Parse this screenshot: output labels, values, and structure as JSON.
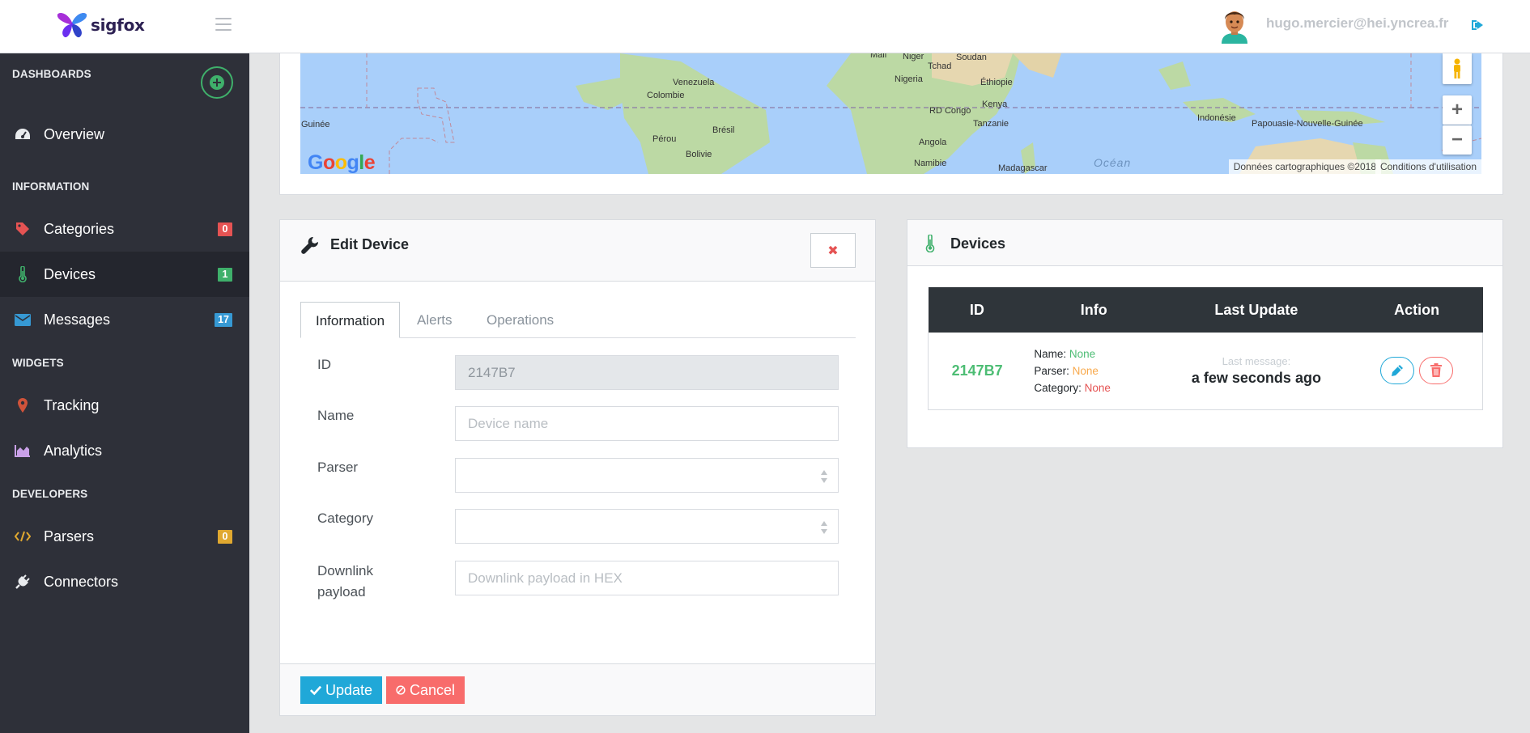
{
  "app": {
    "brand": "sigfox",
    "user_email": "hugo.mercier@hei.yncrea.fr"
  },
  "sidebar": {
    "sections": {
      "dashboards": "DASHBOARDS",
      "information": "INFORMATION",
      "widgets": "WIDGETS",
      "developers": "DEVELOPERS"
    },
    "items": [
      {
        "label": "Overview",
        "icon": "dashboard-icon"
      },
      {
        "label": "Categories",
        "icon": "tag-icon",
        "badge": "0",
        "badge_color": "#e55353"
      },
      {
        "label": "Devices",
        "icon": "thermometer-icon",
        "badge": "1",
        "badge_color": "#3fb06b"
      },
      {
        "label": "Messages",
        "icon": "envelope-icon",
        "badge": "17",
        "badge_color": "#3699d4"
      },
      {
        "label": "Tracking",
        "icon": "map-marker-icon"
      },
      {
        "label": "Analytics",
        "icon": "area-chart-icon"
      },
      {
        "label": "Parsers",
        "icon": "code-icon",
        "badge": "0",
        "badge_color": "#e0a830"
      },
      {
        "label": "Connectors",
        "icon": "plug-icon"
      }
    ]
  },
  "map": {
    "labels": {
      "mali": "Mali",
      "niger": "Niger",
      "soudan": "Soudan",
      "tchad": "Tchad",
      "venezuela": "Venezuela",
      "colombie": "Colombie",
      "nigeria": "Nigeria",
      "ethiopie": "Éthiopie",
      "guinee": "Guinée",
      "kenya": "Kenya",
      "rdcongo": "RD Congo",
      "indonesie": "Indonésie",
      "papouasie": "Papouasie-Nouvelle-Guinée",
      "bresil": "Brésil",
      "tanzanie": "Tanzanie",
      "perou": "Pérou",
      "angola": "Angola",
      "bolivie": "Bolivie",
      "namibie": "Namibie",
      "madagascar": "Madagascar",
      "ocean": "Océan"
    },
    "attribution": "Données cartographiques ©2018",
    "terms": "Conditions d'utilisation",
    "zoom_in": "+",
    "zoom_out": "−"
  },
  "edit_device": {
    "title": "Edit Device",
    "close_symbol": "✖",
    "tabs": [
      "Information",
      "Alerts",
      "Operations"
    ],
    "active_tab": "Information",
    "fields": {
      "id": {
        "label": "ID",
        "value": "2147B7"
      },
      "name": {
        "label": "Name",
        "placeholder": "Device name",
        "value": ""
      },
      "parser": {
        "label": "Parser",
        "value": ""
      },
      "category": {
        "label": "Category",
        "value": ""
      },
      "downlink": {
        "label_line1": "Downlink",
        "label_line2": "payload",
        "placeholder": "Downlink payload in HEX",
        "value": ""
      }
    },
    "update_label": "Update",
    "cancel_label": "Cancel"
  },
  "devices": {
    "title": "Devices",
    "columns": [
      "ID",
      "Info",
      "Last Update",
      "Action"
    ],
    "rows": [
      {
        "id": "2147B7",
        "name_key": "Name:",
        "name_val": "None",
        "parser_key": "Parser:",
        "parser_val": "None",
        "category_key": "Category:",
        "category_val": "None",
        "last_label": "Last message:",
        "last_value": "a few seconds ago"
      }
    ]
  },
  "colors": {
    "sidebar_bg": "#2e3039",
    "accent_blue": "#20a8d8",
    "danger_red": "#f86c6b",
    "success_green": "#4dbd74",
    "warning_orange": "#f8a94c"
  }
}
